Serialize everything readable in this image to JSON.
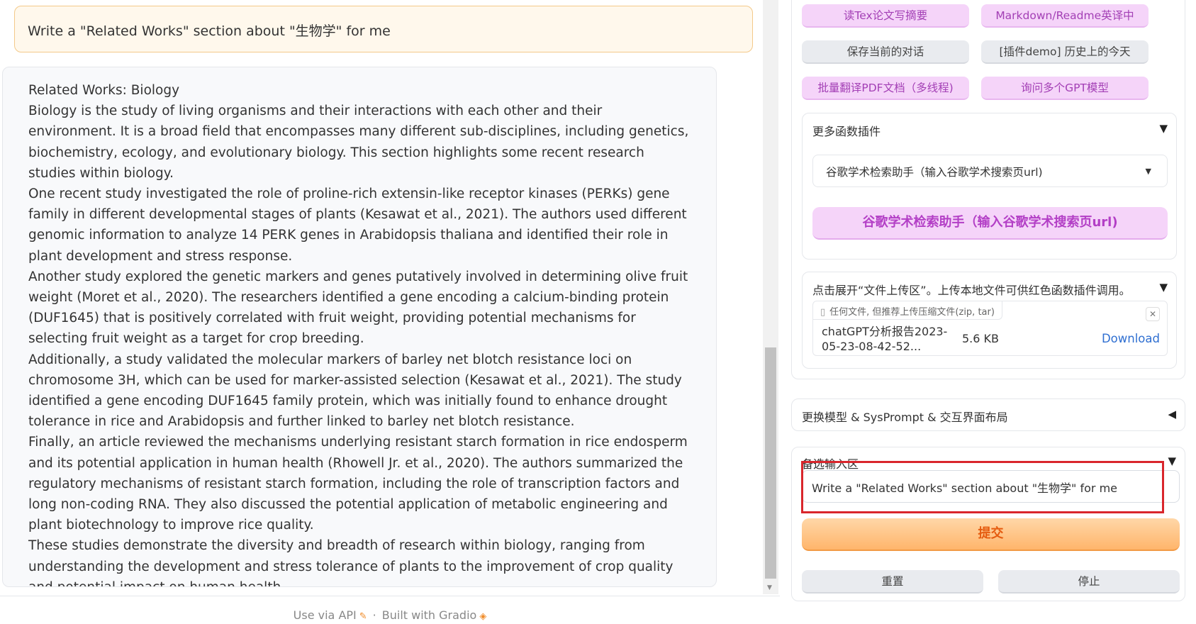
{
  "chat": {
    "user_message": "Write a \"Related Works\" section about \"生物学\" for me",
    "bot_message": [
      "Related Works: Biology",
      "Biology is the study of living organisms and their interactions with each other and their environment. It is a broad field that encompasses many different sub-disciplines, including genetics, biochemistry, ecology, and evolutionary biology. This section highlights some recent research studies within biology.",
      "One recent study investigated the role of proline-rich extensin-like receptor kinases (PERKs) gene family in different developmental stages of plants (Kesawat et al., 2021). The authors used different genomic information to analyze 14 PERK genes in Arabidopsis thaliana and identified their role in plant development and stress response.",
      "Another study explored the genetic markers and genes putatively involved in determining olive fruit weight (Moret et al., 2020). The researchers identified a gene encoding a calcium-binding protein (DUF1645) that is positively correlated with fruit weight, providing potential mechanisms for selecting fruit weight as a target for crop breeding.",
      "Additionally, a study validated the molecular markers of barley net blotch resistance loci on chromosome 3H, which can be used for marker-assisted selection (Kesawat et al., 2021). The study identified a gene encoding DUF1645 family protein, which was initially found to enhance drought tolerance in rice and Arabidopsis and further linked to barley net blotch resistance.",
      "Finally, an article reviewed the mechanisms underlying resistant starch formation in rice endosperm and its potential application in human health (Rhowell Jr. et al., 2020). The authors summarized the regulatory mechanisms of resistant starch formation, including the role of transcription factors and long non-coding RNA. They also discussed the potential application of metabolic engineering and plant biotechnology to improve rice quality.",
      "These studies demonstrate the diversity and breadth of research within biology, ranging from understanding the development and stress tolerance of plants to the improvement of crop quality and potential impact on human health."
    ]
  },
  "footer": {
    "api_label": "Use via API",
    "separator": "·",
    "built_label": "Built with Gradio"
  },
  "plugin_buttons": [
    {
      "label": "读Tex论文写摘要",
      "style": "pink"
    },
    {
      "label": "Markdown/Readme英译中",
      "style": "pink"
    },
    {
      "label": "保存当前的对话",
      "style": "gray"
    },
    {
      "label": "[插件demo] 历史上的今天",
      "style": "gray"
    },
    {
      "label": "批量翻译PDF文档（多线程)",
      "style": "pink"
    },
    {
      "label": "询问多个GPT模型",
      "style": "pink"
    }
  ],
  "more_plugins": {
    "title": "更多函数插件",
    "arrow": "▼",
    "selected": "谷歌学术检索助手（输入谷歌学术搜索页url)",
    "run_button": "谷歌学术检索助手（输入谷歌学术搜索页url)"
  },
  "upload": {
    "title": "点击展开“文件上传区”。上传本地文件可供红色函数插件调用。",
    "arrow": "▼",
    "hint": "任何文件, 但推荐上传压缩文件(zip, tar)",
    "file_name": "chatGPT分析报告2023-05-23-08-42-52...",
    "file_size": "5.6 KB",
    "download_label": "Download"
  },
  "model_section": {
    "title": "更换模型 & SysPrompt & 交互界面布局",
    "arrow": "◀"
  },
  "alt_input": {
    "title": "备选输入区",
    "arrow": "▼",
    "value": "Write a \"Related Works\" section about \"生物学\" for me"
  },
  "actions": {
    "submit": "提交",
    "reset": "重置",
    "stop": "停止"
  }
}
